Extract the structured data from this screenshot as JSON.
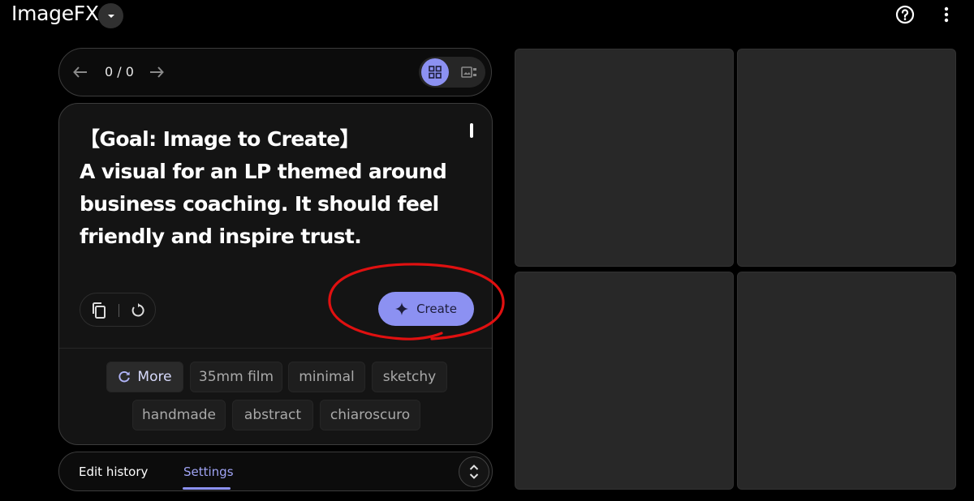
{
  "header": {
    "app_title": "ImageFX",
    "dropdown_icon": "caret-down-icon",
    "help_icon": "help-circle-icon",
    "menu_icon": "more-vert-icon"
  },
  "navigation": {
    "counter": "0 / 0",
    "prev_icon": "arrow-left-icon",
    "next_icon": "arrow-right-icon",
    "grid_view_icon": "grid-view-icon",
    "single_view_icon": "single-view-icon"
  },
  "prompt": {
    "text": "【Goal: Image to Create】\nA visual for an LP themed around business coaching. It should feel friendly and inspire trust.",
    "copy_icon": "copy-icon",
    "reset_icon": "refresh-icon",
    "create_label": "Create",
    "create_icon": "sparkle-icon"
  },
  "chips": {
    "more_label": "More",
    "more_icon": "refresh-icon",
    "items": [
      "35mm film",
      "minimal",
      "sketchy",
      "handmade",
      "abstract",
      "chiaroscuro"
    ]
  },
  "tabs": {
    "edit_history": "Edit history",
    "settings": "Settings",
    "active": "Settings",
    "expand_icon": "unfold-icon"
  },
  "colors": {
    "accent": "#8c91f2",
    "background": "#000000",
    "card": "#141414",
    "tile": "#282828",
    "annotation": "#e01010"
  }
}
